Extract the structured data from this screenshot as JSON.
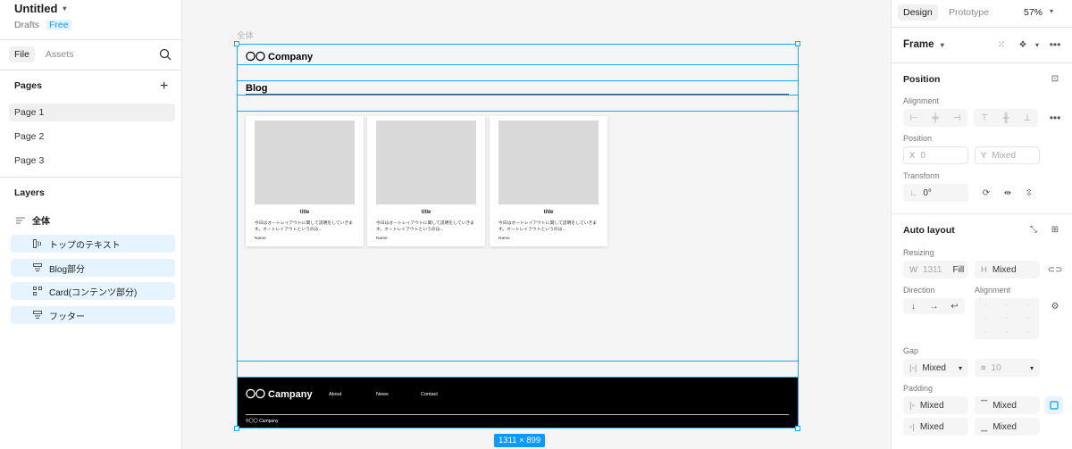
{
  "file": {
    "title": "Untitled",
    "location": "Drafts",
    "plan": "Free"
  },
  "left_tabs": [
    "File",
    "Assets"
  ],
  "pages": {
    "title": "Pages",
    "items": [
      "Page 1",
      "Page 2",
      "Page 3"
    ]
  },
  "layers": {
    "title": "Layers",
    "root": "全体",
    "items": [
      "トップのテキスト",
      "Blog部分",
      "Card(コンテンツ部分)",
      "フッター"
    ]
  },
  "canvas": {
    "frame_label": "全体",
    "header_company": "〇〇 Company",
    "blog_title": "Blog",
    "cards": [
      {
        "title": "title",
        "desc": "今日はオートレイアウトに関して説明をしていきます。オートレイアウトというのは...",
        "name": "Name"
      },
      {
        "title": "title",
        "desc": "今日はオートレイアウトに関して説明をしていきます。オートレイアウトというのは...",
        "name": "Name"
      },
      {
        "title": "title",
        "desc": "今日はオートレイアウトに関して説明をしていきます。オートレイアウトというのは...",
        "name": "Name"
      }
    ],
    "footer": {
      "brand": "〇〇 Campany",
      "nav": [
        "About",
        "News",
        "Contact"
      ],
      "copyright": "©〇〇 Campany"
    },
    "size_badge": "1311 × 899"
  },
  "right": {
    "tabs": [
      "Design",
      "Prototype"
    ],
    "zoom": "57%",
    "frame_type": "Frame",
    "position_title": "Position",
    "alignment_label": "Alignment",
    "position_label": "Position",
    "x": {
      "prefix": "X",
      "value": "0"
    },
    "y": {
      "prefix": "Y",
      "value": "Mixed"
    },
    "transform_label": "Transform",
    "rotation": "0°",
    "autolayout_title": "Auto layout",
    "resizing_label": "Resizing",
    "w": {
      "prefix": "W",
      "value": "1311",
      "mode": "Fill"
    },
    "h": {
      "prefix": "H",
      "value": "Mixed"
    },
    "direction_label": "Direction",
    "alignment2_label": "Alignment",
    "gap_label": "Gap",
    "gap_value": "Mixed",
    "gap_secondary": "10",
    "padding_label": "Padding",
    "padding": [
      "Mixed",
      "Mixed",
      "Mixed",
      "Mixed"
    ]
  },
  "colors": {
    "accent": "#0d99ff",
    "selection": "#1ea7ff",
    "layer_highlight": "#e5f4ff"
  }
}
